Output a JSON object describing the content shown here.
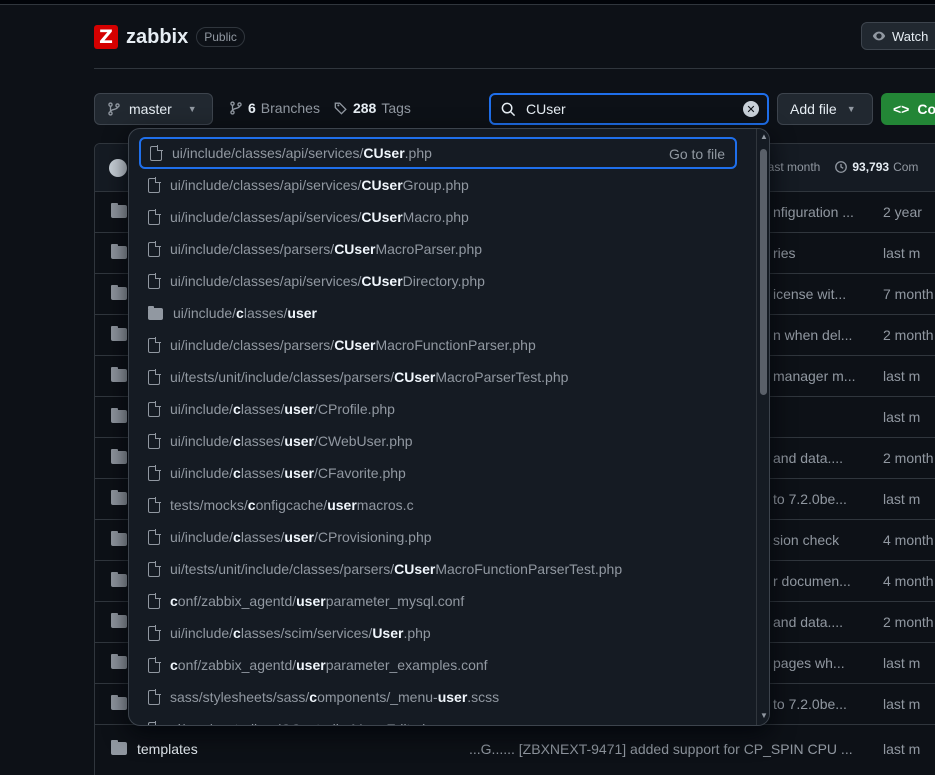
{
  "repo": {
    "logo_letter": "Z",
    "name": "zabbix",
    "visibility": "Public",
    "watch_label": "Watch"
  },
  "toolbar": {
    "branch": "master",
    "branches_count": "6",
    "branches_label": "Branches",
    "tags_count": "288",
    "tags_label": "Tags",
    "search_value": "CUser",
    "add_file_label": "Add file",
    "code_label": "Co"
  },
  "commit": {
    "time": "last month",
    "commits_count": "93,793",
    "commits_label": "Com"
  },
  "files": [
    {
      "msg": "nfiguration ...",
      "date": "2 year"
    },
    {
      "msg": "ries",
      "date": "last m"
    },
    {
      "msg": "icense wit...",
      "date": "7 month"
    },
    {
      "msg": "n when del...",
      "date": "2 month"
    },
    {
      "msg": "manager m...",
      "date": "last m"
    },
    {
      "msg": "",
      "date": "last m"
    },
    {
      "msg": "and data....",
      "date": "2 month"
    },
    {
      "msg": "to 7.2.0be...",
      "date": "last m"
    },
    {
      "msg": "sion check",
      "date": "4 month"
    },
    {
      "msg": "r documen...",
      "date": "4 month"
    },
    {
      "msg": "and data....",
      "date": "2 month"
    },
    {
      "msg": "pages wh...",
      "date": "last m"
    },
    {
      "msg": "to 7.2.0be...",
      "date": "last m"
    }
  ],
  "templates_row": {
    "name": "templates",
    "msg": "...G...... [ZBXNEXT-9471] added support for CP_SPIN CPU ...",
    "date": "last m"
  },
  "dropdown": {
    "goto_label": "Go to file",
    "items": [
      {
        "type": "file",
        "parts": [
          [
            "ui/include/classes/api/services/",
            false
          ],
          [
            "CUser",
            true
          ],
          [
            ".php",
            false
          ]
        ]
      },
      {
        "type": "file",
        "parts": [
          [
            "ui/include/classes/api/services/",
            false
          ],
          [
            "CUser",
            true
          ],
          [
            "Group.php",
            false
          ]
        ]
      },
      {
        "type": "file",
        "parts": [
          [
            "ui/include/classes/api/services/",
            false
          ],
          [
            "CUser",
            true
          ],
          [
            "Macro.php",
            false
          ]
        ]
      },
      {
        "type": "file",
        "parts": [
          [
            "ui/include/classes/parsers/",
            false
          ],
          [
            "CUser",
            true
          ],
          [
            "MacroParser.php",
            false
          ]
        ]
      },
      {
        "type": "file",
        "parts": [
          [
            "ui/include/classes/api/services/",
            false
          ],
          [
            "CUser",
            true
          ],
          [
            "Directory.php",
            false
          ]
        ]
      },
      {
        "type": "dir",
        "parts": [
          [
            "ui/include/",
            false
          ],
          [
            "c",
            true
          ],
          [
            "lasses/",
            false
          ],
          [
            "user",
            true
          ]
        ]
      },
      {
        "type": "file",
        "parts": [
          [
            "ui/include/classes/parsers/",
            false
          ],
          [
            "CUser",
            true
          ],
          [
            "MacroFunctionParser.php",
            false
          ]
        ]
      },
      {
        "type": "file",
        "parts": [
          [
            "ui/tests/unit/include/classes/parsers/",
            false
          ],
          [
            "CUser",
            true
          ],
          [
            "MacroParserTest.php",
            false
          ]
        ]
      },
      {
        "type": "file",
        "parts": [
          [
            "ui/include/",
            false
          ],
          [
            "c",
            true
          ],
          [
            "lasses/",
            false
          ],
          [
            "user",
            true
          ],
          [
            "/CProfile.php",
            false
          ]
        ]
      },
      {
        "type": "file",
        "parts": [
          [
            "ui/include/",
            false
          ],
          [
            "c",
            true
          ],
          [
            "lasses/",
            false
          ],
          [
            "user",
            true
          ],
          [
            "/CWebUser.php",
            false
          ]
        ]
      },
      {
        "type": "file",
        "parts": [
          [
            "ui/include/",
            false
          ],
          [
            "c",
            true
          ],
          [
            "lasses/",
            false
          ],
          [
            "user",
            true
          ],
          [
            "/CFavorite.php",
            false
          ]
        ]
      },
      {
        "type": "file",
        "parts": [
          [
            "tests/mocks/",
            false
          ],
          [
            "c",
            true
          ],
          [
            "onfigcache/",
            false
          ],
          [
            "user",
            true
          ],
          [
            "macros.c",
            false
          ]
        ]
      },
      {
        "type": "file",
        "parts": [
          [
            "ui/include/",
            false
          ],
          [
            "c",
            true
          ],
          [
            "lasses/",
            false
          ],
          [
            "user",
            true
          ],
          [
            "/CProvisioning.php",
            false
          ]
        ]
      },
      {
        "type": "file",
        "parts": [
          [
            "ui/tests/unit/include/classes/parsers/",
            false
          ],
          [
            "CUser",
            true
          ],
          [
            "MacroFunctionParserTest.php",
            false
          ]
        ]
      },
      {
        "type": "file",
        "parts": [
          [
            "c",
            true
          ],
          [
            "onf/zabbix_agentd/",
            false
          ],
          [
            "user",
            true
          ],
          [
            "parameter_mysql.conf",
            false
          ]
        ]
      },
      {
        "type": "file",
        "parts": [
          [
            "ui/include/",
            false
          ],
          [
            "c",
            true
          ],
          [
            "lasses/scim/services/",
            false
          ],
          [
            "User",
            true
          ],
          [
            ".php",
            false
          ]
        ]
      },
      {
        "type": "file",
        "parts": [
          [
            "c",
            true
          ],
          [
            "onf/zabbix_agentd/",
            false
          ],
          [
            "user",
            true
          ],
          [
            "parameter_examples.conf",
            false
          ]
        ]
      },
      {
        "type": "file",
        "parts": [
          [
            "sass/stylesheets/sass/",
            false
          ],
          [
            "c",
            true
          ],
          [
            "omponents/_menu-",
            false
          ],
          [
            "user",
            true
          ],
          [
            ".scss",
            false
          ]
        ]
      },
      {
        "type": "file",
        "parts": [
          [
            "ui/app/controllers/CControllerMenuEdit.php",
            false
          ]
        ]
      }
    ]
  }
}
